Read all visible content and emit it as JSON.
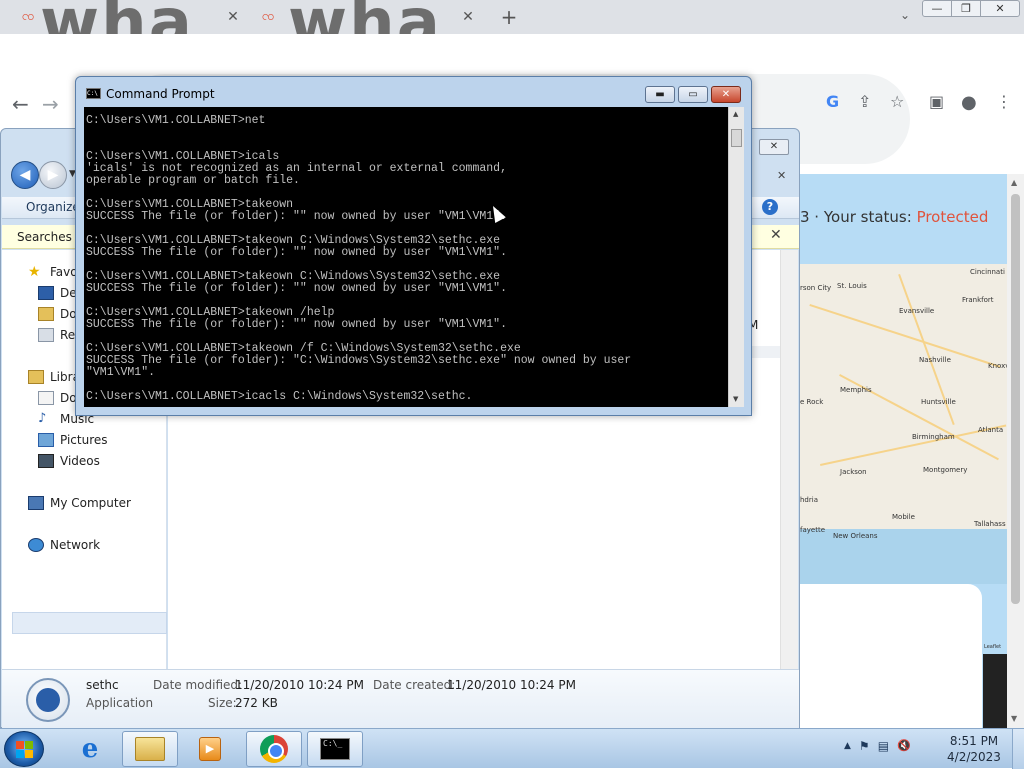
{
  "chrome": {
    "tabs": [
      {
        "title": "wha",
        "favicon": "brand-icon"
      },
      {
        "title": "wha",
        "favicon": "brand-icon"
      }
    ],
    "tab_close": "✕",
    "new_tab": "+",
    "tab_search": "⌄",
    "window_controls": {
      "minimize": "—",
      "maximize": "❐",
      "close": "✕"
    },
    "nav": {
      "back": "←",
      "forward": "→"
    },
    "toolbar_icons": {
      "google": "G",
      "share": "⇪",
      "bookmark": "☆",
      "sidepanel": "▣",
      "profile": "●",
      "menu": "⋮"
    }
  },
  "page": {
    "status_prefix": "3 · Your status: ",
    "status_value": "Protected",
    "status_color": "#e0533c",
    "map_cities": [
      {
        "name": "Cincinnati"
      },
      {
        "name": "St. Louis"
      },
      {
        "name": "rson City"
      },
      {
        "name": "Frankfort"
      },
      {
        "name": "Evansville"
      },
      {
        "name": "Nashville"
      },
      {
        "name": "Knoxv"
      },
      {
        "name": "Memphis"
      },
      {
        "name": "Huntsville"
      },
      {
        "name": "e Rock"
      },
      {
        "name": "Atlanta"
      },
      {
        "name": "Birmingham"
      },
      {
        "name": "Jackson"
      },
      {
        "name": "Montgomery"
      },
      {
        "name": "hdria"
      },
      {
        "name": "Mobile"
      },
      {
        "name": "Tallahass"
      },
      {
        "name": "fayette"
      },
      {
        "name": "New Orleans"
      }
    ],
    "map_attribution": "Leaflet"
  },
  "explorer": {
    "close_label": "✕",
    "organize": "Organize",
    "help": "?",
    "infobar": "Searches m",
    "infobar_close": "✕",
    "search_clear": "✕",
    "nav_items": [
      {
        "label": "Favo",
        "icon": "star-icon"
      },
      {
        "label": "Des",
        "icon": "desktop-icon"
      },
      {
        "label": "Dov",
        "icon": "downloads-icon"
      },
      {
        "label": "Rec",
        "icon": "recent-icon"
      },
      {
        "label": "Libra",
        "icon": "library-icon"
      },
      {
        "label": "Doc",
        "icon": "documents-icon"
      },
      {
        "label": "Music",
        "icon": "music-icon"
      },
      {
        "label": "Pictures",
        "icon": "pictures-icon"
      },
      {
        "label": "Videos",
        "icon": "videos-icon"
      },
      {
        "label": "My Computer",
        "icon": "computer-icon"
      },
      {
        "label": "Network",
        "icon": "network-icon"
      }
    ],
    "main_fragment": "M",
    "details": {
      "name": "sethc",
      "type": "Application",
      "date_modified_label": "Date modified:",
      "date_modified": "11/20/2010 10:24 PM",
      "date_created_label": "Date created:",
      "date_created": "11/20/2010 10:24 PM",
      "size_label": "Size:",
      "size": "272 KB"
    }
  },
  "cmd": {
    "title": "Command Prompt",
    "icon_text": "C:\\",
    "buttons": {
      "minimize": "▬",
      "maximize": "▭",
      "close": "✕"
    },
    "output": "C:\\Users\\VM1.COLLABNET>net\n\n\nC:\\Users\\VM1.COLLABNET>icals\n'icals' is not recognized as an internal or external command,\noperable program or batch file.\n\nC:\\Users\\VM1.COLLABNET>takeown\nSUCCESS The file (or folder): \"\" now owned by user \"VM1\\VM1\".\n\nC:\\Users\\VM1.COLLABNET>takeown C:\\Windows\\System32\\sethc.exe\nSUCCESS The file (or folder): \"\" now owned by user \"VM1\\VM1\".\n\nC:\\Users\\VM1.COLLABNET>takeown C:\\Windows\\System32\\sethc.exe\nSUCCESS The file (or folder): \"\" now owned by user \"VM1\\VM1\".\n\nC:\\Users\\VM1.COLLABNET>takeown /help\nSUCCESS The file (or folder): \"\" now owned by user \"VM1\\VM1\".\n\nC:\\Users\\VM1.COLLABNET>takeown /f C:\\Windows\\System32\\sethc.exe\nSUCCESS The file (or folder): \"C:\\Windows\\System32\\sethc.exe\" now owned by user\n\"VM1\\VM1\".\n\nC:\\Users\\VM1.COLLABNET>icacls C:\\Windows\\System32\\sethc."
  },
  "taskbar": {
    "items": [
      {
        "name": "internet-explorer",
        "label": "e"
      },
      {
        "name": "windows-explorer"
      },
      {
        "name": "media-player",
        "label": "▶"
      },
      {
        "name": "google-chrome"
      },
      {
        "name": "command-prompt",
        "label": "C:\\_"
      }
    ],
    "tray": {
      "chevron": "▲",
      "flag": "⚑",
      "network": "▤",
      "volume": "🔇"
    },
    "time": "8:51 PM",
    "date": "4/2/2023"
  }
}
